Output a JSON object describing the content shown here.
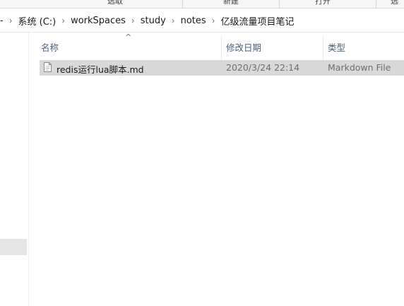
{
  "ribbon": {
    "labels": [
      "选取",
      "新建",
      "打开",
      "选"
    ]
  },
  "address": {
    "partial_left": "-",
    "crumbs": [
      "系统 (C:)",
      "workSpaces",
      "study",
      "notes",
      "亿级流量项目笔记"
    ]
  },
  "columns": {
    "name": "名称",
    "date": "修改日期",
    "type": "类型",
    "sort_indicator": "^"
  },
  "files": [
    {
      "name": "redis运行lua脚本.md",
      "modified": "2020/3/24 22:14",
      "type": "Markdown File",
      "icon": "markdown-file-icon",
      "selected": true
    }
  ],
  "colors": {
    "selected_row": "#d9d9d9",
    "header_text": "#4c607a",
    "nav_selected": "#e5e5e5"
  }
}
